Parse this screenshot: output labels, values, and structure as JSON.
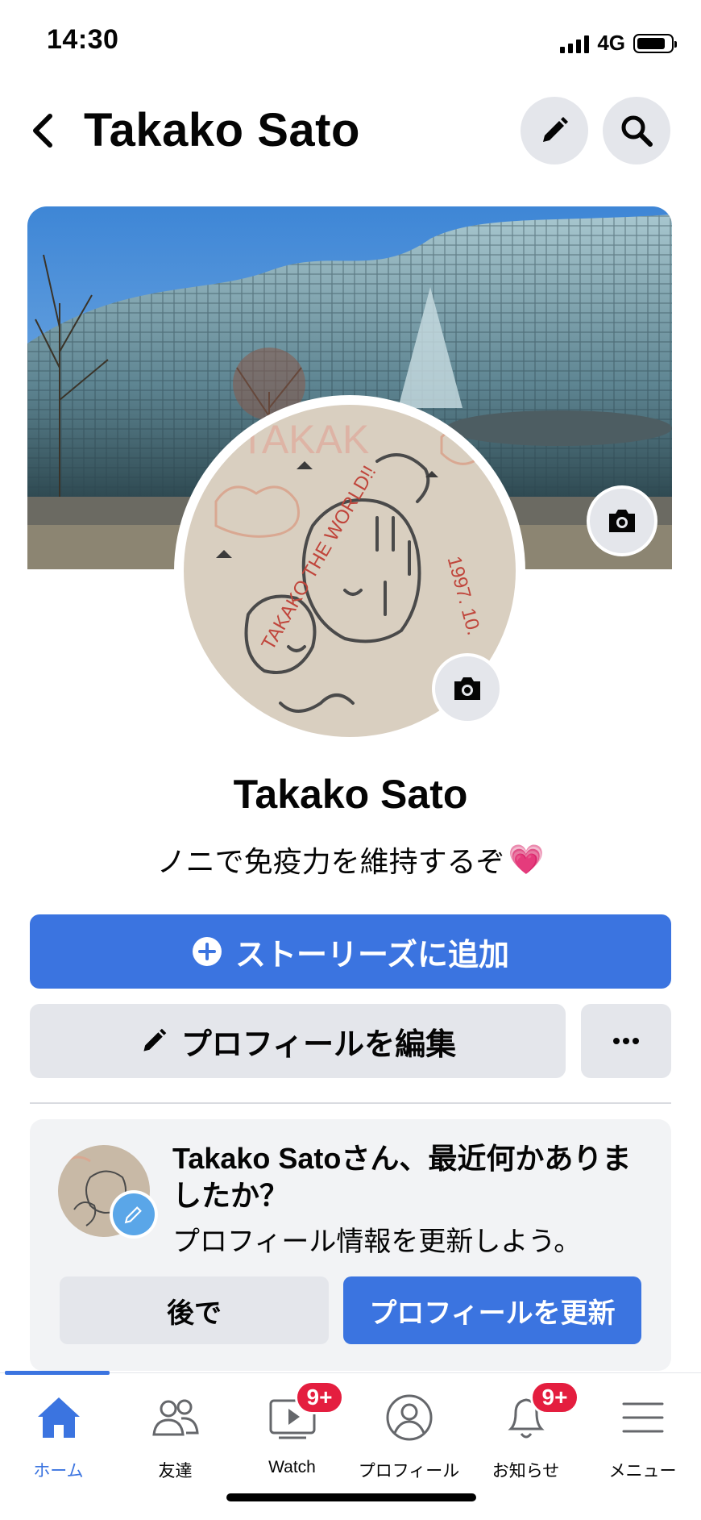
{
  "status_bar": {
    "time": "14:30",
    "network": "4G"
  },
  "header": {
    "title": "Takako Sato",
    "icons": [
      "back-chevron-icon",
      "pencil-icon",
      "search-icon"
    ]
  },
  "profile": {
    "name": "Takako Sato",
    "bio": "ノニで免疫力を維持するぞ",
    "bio_emoji": "💗",
    "avatar_text": [
      "TAKAKO THE WORLD!!",
      "1997. 10."
    ]
  },
  "actions": {
    "add_story": "ストーリーズに追加",
    "edit_profile": "プロフィールを編集",
    "more": "···"
  },
  "prompt_card": {
    "name": "Takako Sato",
    "question": "さん、最近何かありましたか？",
    "subtitle": "プロフィール情報を更新しよう。",
    "later": "後で",
    "update": "プロフィールを更新"
  },
  "tabs": [
    {
      "label": "ホーム",
      "icon": "home-icon",
      "active": true
    },
    {
      "label": "友達",
      "icon": "friends-icon"
    },
    {
      "label": "Watch",
      "icon": "watch-icon",
      "badge": "9+"
    },
    {
      "label": "プロフィール",
      "icon": "profile-icon"
    },
    {
      "label": "お知らせ",
      "icon": "bell-icon",
      "badge": "9+"
    },
    {
      "label": "メニュー",
      "icon": "menu-icon"
    }
  ],
  "colors": {
    "accent": "#3b74e0",
    "badge": "#e41e3f",
    "button_gray": "#e4e6eb"
  }
}
